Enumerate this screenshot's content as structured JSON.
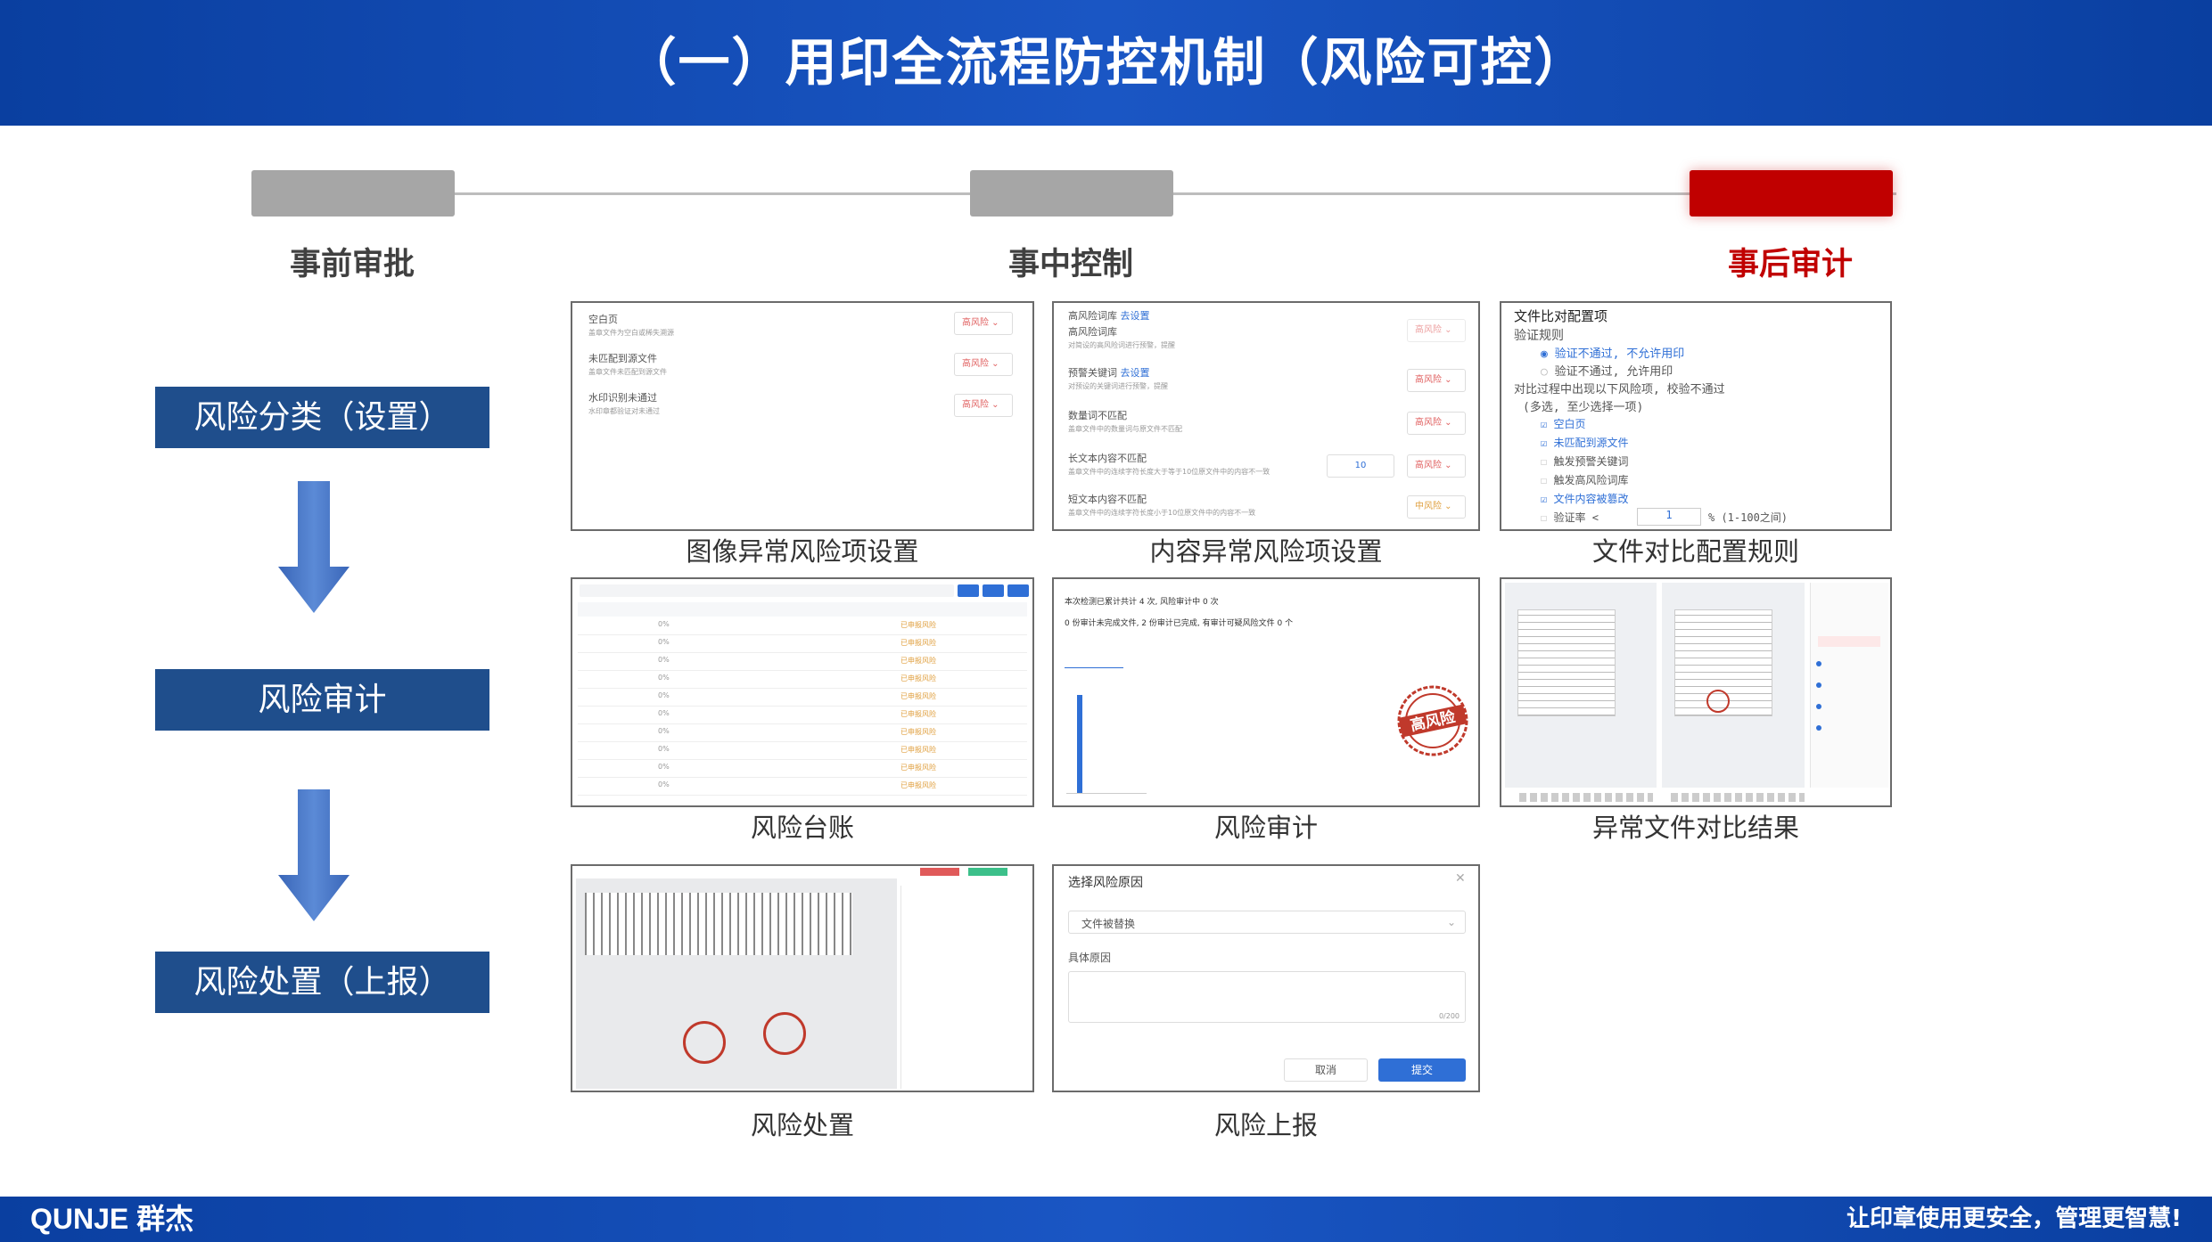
{
  "header": {
    "title": "（一）用印全流程防控机制（风险可控）"
  },
  "footer": {
    "logo": "QUNJE 群杰",
    "slogan": "让印章使用更安全，管理更智慧!"
  },
  "colors": {
    "brand_blue": "#0a3fa0",
    "flow_box": "#1f4e8c",
    "stage_grey": "#a6a6a6",
    "stage_active": "#c00000",
    "arrow": "#4472c4"
  },
  "timeline": {
    "stages": [
      {
        "label": "事前审批",
        "active": false
      },
      {
        "label": "事中控制",
        "active": false
      },
      {
        "label": "事后审计",
        "active": true
      }
    ]
  },
  "flow": {
    "steps": [
      {
        "label": "风险分类（设置）"
      },
      {
        "label": "风险审计"
      },
      {
        "label": "风险处置（上报）"
      }
    ]
  },
  "panels": {
    "image_risk": {
      "caption": "图像异常风险项设置",
      "items": [
        {
          "title": "空白页",
          "desc": "盖章文件为空白或稀失溯源",
          "level": "高风险"
        },
        {
          "title": "未匹配到源文件",
          "desc": "盖章文件未匹配到源文件",
          "level": "高风险"
        },
        {
          "title": "水印识别未通过",
          "desc": "水印章都验证对未通过",
          "level": "高风险"
        }
      ]
    },
    "content_risk": {
      "caption": "内容异常风险项设置",
      "items": [
        {
          "title": "高风险词库",
          "link": "去设置",
          "sub": "高风险词库",
          "desc": "对简设的高风险词进行预警，提醒",
          "level": "高风险"
        },
        {
          "title": "预警关键词",
          "link": "去设置",
          "desc": "对预设的关键词进行预警，提醒",
          "level": "高风险"
        },
        {
          "title": "数量词不匹配",
          "desc": "盖章文件中的数量词与原文件不匹配",
          "level": "高风险"
        },
        {
          "title": "长文本内容不匹配",
          "desc": "盖章文件中的连续字符长度大于等于10位原文件中的内容不一致",
          "value": "10",
          "level": "高风险"
        },
        {
          "title": "短文本内容不匹配",
          "desc": "盖章文件中的连续字符长度小于10位原文件中的内容不一致",
          "level": "中风险"
        }
      ]
    },
    "compare_rules": {
      "caption": "文件对比配置规则",
      "title": "文件比对配置项",
      "rule_label": "验证规则",
      "options": [
        "验证不通过, 不允许用印",
        "验证不通过, 允许用印"
      ],
      "condition": "对比过程中出现以下风险项, 校验不通过",
      "hint": "(多选, 至少选择一项)",
      "checks": [
        {
          "label": "空白页",
          "checked": true
        },
        {
          "label": "未匹配到源文件",
          "checked": true
        },
        {
          "label": "触发预警关键词",
          "checked": false
        },
        {
          "label": "触发高风险词库",
          "checked": false
        },
        {
          "label": "文件内容被篡改",
          "checked": true
        },
        {
          "label": "验证率 <",
          "checked": false
        }
      ],
      "rate_value": "1",
      "rate_hint": "% (1-100之间)"
    },
    "ledger": {
      "caption": "风险台账",
      "percent": "0%",
      "status": "已申报风险"
    },
    "audit": {
      "caption": "风险审计",
      "summary": "本次检测已累计共计 4 次, 风险审计中 0 次",
      "summary2": "0 份审计未完成文件, 2 份审计已完成, 有审计可疑风险文件 0 个",
      "stamp_text": "高风险"
    },
    "diff_result": {
      "caption": "异常文件对比结果"
    },
    "handling": {
      "caption": "风险处置"
    },
    "report": {
      "caption": "风险上报",
      "title": "选择风险原因",
      "select_value": "文件被替换",
      "reason_label": "具体原因",
      "counter": "0/200",
      "cancel": "取消",
      "submit": "提交"
    }
  }
}
